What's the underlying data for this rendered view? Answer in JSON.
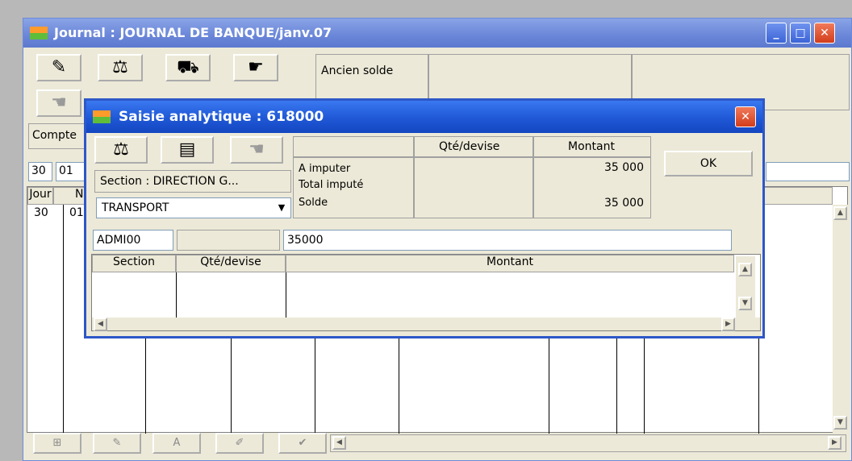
{
  "main_window": {
    "title": "Journal : JOURNAL DE BANQUE/janv.07",
    "caption_buttons": {
      "minimize": "_",
      "maximize": "□",
      "close": "✕"
    },
    "toolbar_icons": [
      "scales-icon",
      "balance-icon",
      "vehicle-icon",
      "hand-icon",
      "hand-grey-icon"
    ],
    "ancien_solde_label": "Ancien solde",
    "compte_label": "Compte",
    "entry_row": {
      "jour": "30",
      "num": "01"
    },
    "grid_headers": {
      "jour": "Jour",
      "num": "N"
    },
    "grid_rows": [
      {
        "jour": "30",
        "num": "01"
      }
    ]
  },
  "dialog": {
    "title": "Saisie analytique : 618000",
    "headers": {
      "qte_devise": "Qté/devise",
      "montant": "Montant"
    },
    "summary": [
      {
        "label": "A imputer",
        "value": "35 000"
      },
      {
        "label": "Total imputé",
        "value": ""
      },
      {
        "label": "Solde",
        "value": "35 000"
      }
    ],
    "section_label": "Section : DIRECTION G...",
    "section_select": "TRANSPORT",
    "ok_label": "OK",
    "input_code": "ADMI00",
    "input_qte": "",
    "input_montant": "35000",
    "table_headers": {
      "section": "Section",
      "qte_devise": "Qté/devise",
      "montant": "Montant"
    }
  },
  "colors": {
    "titlebar_active": "#1f58d6",
    "titlebar_inactive": "#7a96de",
    "window_bg": "#ece9d8",
    "close_red": "#d23d1b"
  }
}
